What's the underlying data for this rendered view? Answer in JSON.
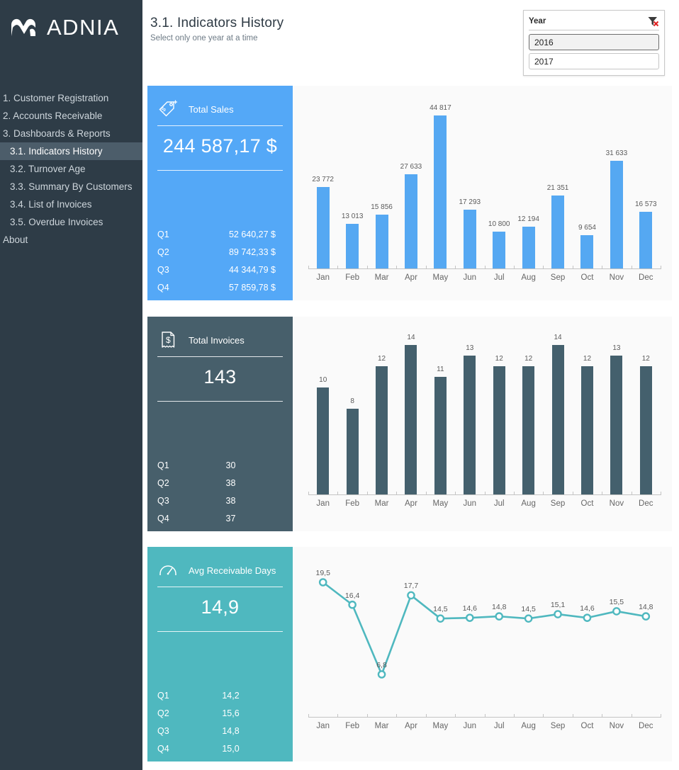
{
  "brand": {
    "name_bold": "ADN",
    "name_thin": "IA",
    "logo_icon": "adnia-logo-mark"
  },
  "sidebar": {
    "items": [
      {
        "label": "1. Customer Registration",
        "level": 0,
        "active": false
      },
      {
        "label": "2. Accounts Receivable",
        "level": 0,
        "active": false
      },
      {
        "label": "3. Dashboards & Reports",
        "level": 0,
        "active": false
      },
      {
        "label": "3.1. Indicators History",
        "level": 1,
        "active": true
      },
      {
        "label": "3.2. Turnover Age",
        "level": 1,
        "active": false
      },
      {
        "label": "3.3. Summary By Customers",
        "level": 1,
        "active": false
      },
      {
        "label": "3.4. List of Invoices",
        "level": 1,
        "active": false
      },
      {
        "label": "3.5. Overdue Invoices",
        "level": 1,
        "active": false
      },
      {
        "label": "About",
        "level": 0,
        "active": false
      }
    ]
  },
  "header": {
    "title": "3.1. Indicators History",
    "subtitle": "Select only one year at a time"
  },
  "slicer": {
    "title": "Year",
    "clear_icon": "clear-filter-icon",
    "options": [
      {
        "label": "2016",
        "selected": true
      },
      {
        "label": "2017",
        "selected": false
      }
    ]
  },
  "cards": [
    {
      "id": "total-sales",
      "icon": "price-tag-dollar-icon",
      "label": "Total Sales",
      "value": "244 587,17 $",
      "color": "#54a8f7",
      "quarters": [
        {
          "q": "Q1",
          "v": "52 640,27 $"
        },
        {
          "q": "Q2",
          "v": "89 742,33 $"
        },
        {
          "q": "Q3",
          "v": "44 344,79 $"
        },
        {
          "q": "Q4",
          "v": "57 859,78 $"
        }
      ]
    },
    {
      "id": "total-invoices",
      "icon": "invoice-dollar-icon",
      "label": "Total Invoices",
      "value": "143",
      "color": "#475f6b",
      "quarters": [
        {
          "q": "Q1",
          "v": "30"
        },
        {
          "q": "Q2",
          "v": "38"
        },
        {
          "q": "Q3",
          "v": "38"
        },
        {
          "q": "Q4",
          "v": "37"
        }
      ]
    },
    {
      "id": "avg-receivable-days",
      "icon": "gauge-icon",
      "label": "Avg Receivable Days",
      "value": "14,9",
      "color": "#4fb8bf",
      "quarters": [
        {
          "q": "Q1",
          "v": "14,2"
        },
        {
          "q": "Q2",
          "v": "15,6"
        },
        {
          "q": "Q3",
          "v": "14,8"
        },
        {
          "q": "Q4",
          "v": "15,0"
        }
      ]
    }
  ],
  "chart_data": [
    {
      "type": "bar",
      "id": "total-sales-chart",
      "title": "Total Sales",
      "categories": [
        "Jan",
        "Feb",
        "Mar",
        "Apr",
        "May",
        "Jun",
        "Jul",
        "Aug",
        "Sep",
        "Oct",
        "Nov",
        "Dec"
      ],
      "values": [
        23772,
        13013,
        15856,
        27633,
        44817,
        17293,
        10800,
        12194,
        21351,
        9654,
        31633,
        16573
      ],
      "labels": [
        "23 772",
        "13 013",
        "15 856",
        "27 633",
        "44 817",
        "17 293",
        "10 800",
        "12 194",
        "21 351",
        "9 654",
        "31 633",
        "16 573"
      ],
      "color": "#55a8f2",
      "xlabel": "",
      "ylabel": "",
      "ylim": [
        0,
        44817
      ],
      "grid": false,
      "legend": false
    },
    {
      "type": "bar",
      "id": "total-invoices-chart",
      "title": "Total Invoices",
      "categories": [
        "Jan",
        "Feb",
        "Mar",
        "Apr",
        "May",
        "Jun",
        "Jul",
        "Aug",
        "Sep",
        "Oct",
        "Nov",
        "Dec"
      ],
      "values": [
        10,
        8,
        12,
        14,
        11,
        13,
        12,
        12,
        14,
        12,
        13,
        12
      ],
      "labels": [
        "10",
        "8",
        "12",
        "14",
        "11",
        "13",
        "12",
        "12",
        "14",
        "12",
        "13",
        "12"
      ],
      "color": "#44606d",
      "xlabel": "",
      "ylabel": "",
      "ylim": [
        0,
        14
      ],
      "grid": false,
      "legend": false
    },
    {
      "type": "line",
      "id": "avg-receivable-days-chart",
      "title": "Avg Receivable Days",
      "categories": [
        "Jan",
        "Feb",
        "Mar",
        "Apr",
        "May",
        "Jun",
        "Jul",
        "Aug",
        "Sep",
        "Oct",
        "Nov",
        "Dec"
      ],
      "values": [
        19.5,
        16.4,
        6.8,
        17.7,
        14.5,
        14.6,
        14.8,
        14.5,
        15.1,
        14.6,
        15.5,
        14.8
      ],
      "labels": [
        "19,5",
        "16,4",
        "6,8",
        "17,7",
        "14,5",
        "14,6",
        "14,8",
        "14,5",
        "15,1",
        "14,6",
        "15,5",
        "14,8"
      ],
      "color": "#4fb8bf",
      "xlabel": "",
      "ylabel": "",
      "ylim": [
        0,
        21
      ],
      "grid": false,
      "legend": false
    }
  ]
}
